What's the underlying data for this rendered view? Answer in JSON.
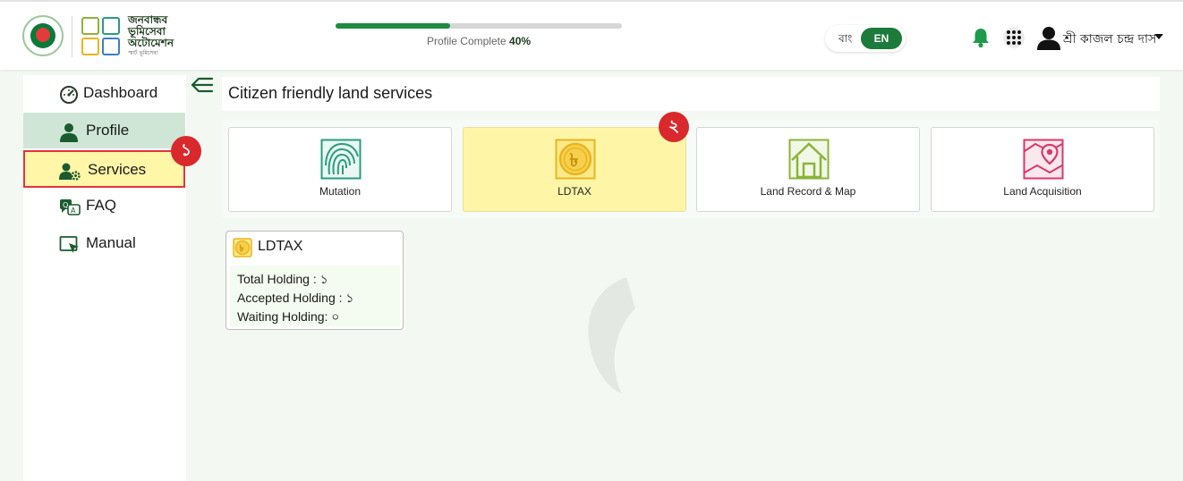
{
  "header": {
    "logo_text_lines": [
      "জনবান্ধব",
      "ভূমিসেবা",
      "অটোমেশন"
    ],
    "logo_tagline": "স্মার্ট ভূমিসেবা",
    "progress": {
      "label": "Profile Complete",
      "value": "40%",
      "fraction": 0.4
    },
    "lang": {
      "bn": "বাং",
      "en": "EN",
      "active": "EN"
    },
    "user_name": "শ্রী কাজল চন্দ্র দাস",
    "icons": [
      "bell-icon",
      "apps-grid-icon",
      "user-avatar-icon",
      "caret-down-icon"
    ]
  },
  "sidebar": {
    "items": [
      {
        "label": "Dashboard",
        "icon": "dashboard-gauge-icon"
      },
      {
        "label": "Profile",
        "icon": "person-icon"
      },
      {
        "label": "Services",
        "icon": "services-gear-user-icon"
      },
      {
        "label": "FAQ",
        "icon": "faq-chat-icon"
      },
      {
        "label": "Manual",
        "icon": "manual-cursor-icon"
      }
    ],
    "active": "Profile",
    "highlighted": "Services",
    "badges": {
      "services": "১",
      "ldtax": "২"
    }
  },
  "main": {
    "title": "Citizen friendly land services",
    "cards": [
      {
        "label": "Mutation",
        "icon": "fingerprint-icon",
        "color": "#2a9d7f"
      },
      {
        "label": "LDTAX",
        "icon": "taka-coin-icon",
        "color": "#e8b520"
      },
      {
        "label": "Land Record & Map",
        "icon": "house-icon",
        "color": "#8bb33a"
      },
      {
        "label": "Land Acquisition",
        "icon": "map-pin-icon",
        "color": "#d83a6a"
      }
    ],
    "selected_card": "LDTAX",
    "summary": {
      "title": "LDTAX",
      "lines": [
        "Total Holding : ১",
        "Accepted Holding : ১",
        "Waiting Holding: ০"
      ]
    }
  },
  "colors": {
    "brand_green": "#1c7a3a",
    "accent_red": "#d9292d",
    "highlight_yellow": "#fff5a6"
  }
}
